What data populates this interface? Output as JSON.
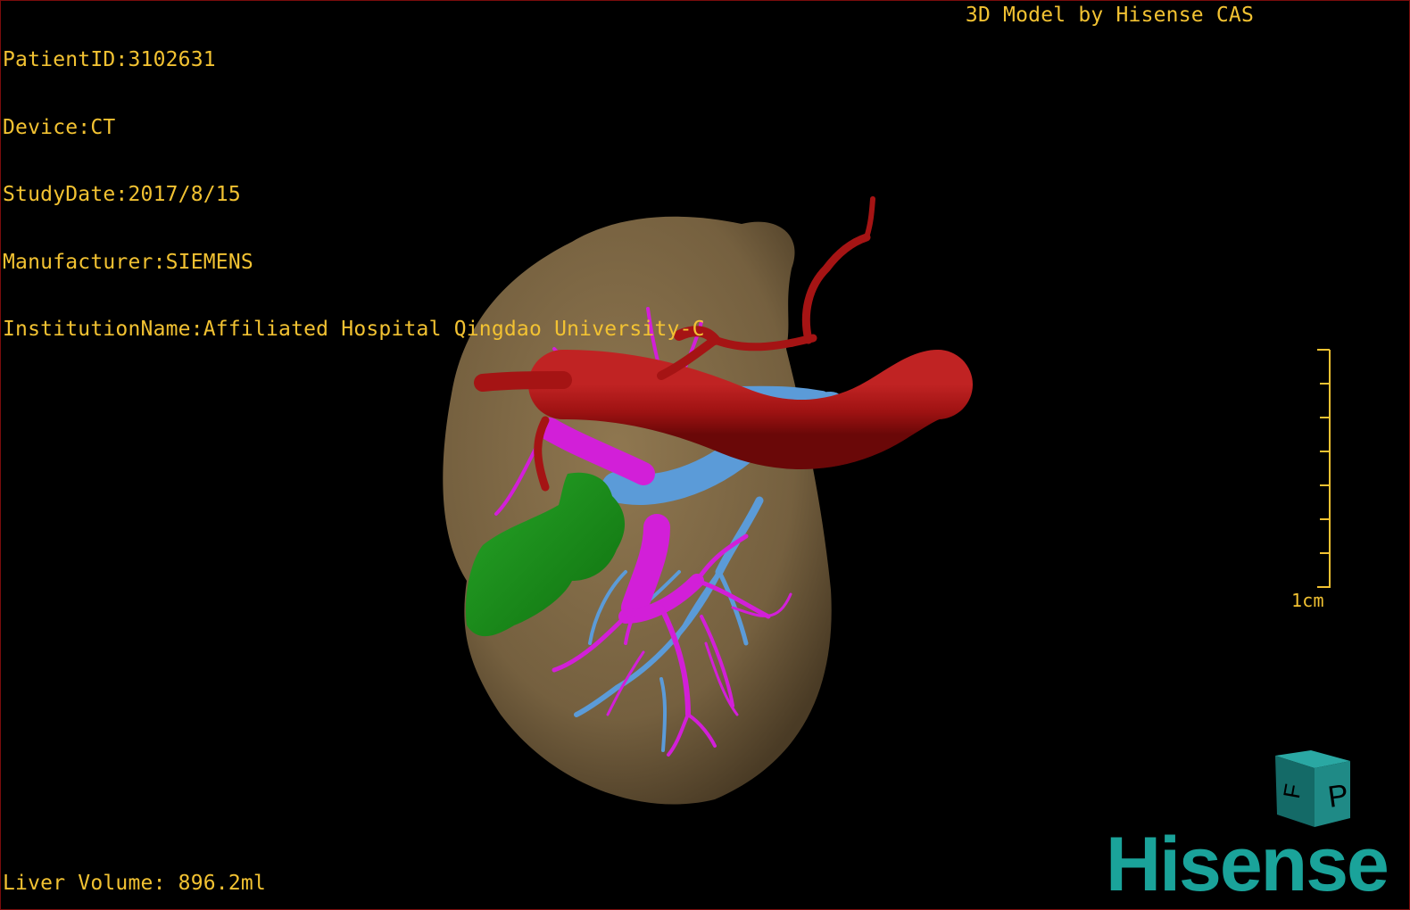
{
  "info": {
    "patient_id": "PatientID:3102631",
    "device": "Device:CT",
    "study_date": "StudyDate:2017/8/15",
    "manufacturer": "Manufacturer:SIEMENS",
    "institution": "InstitutionName:Affiliated Hospital Qingdao University-C"
  },
  "brand_text": "3D Model by Hisense CAS",
  "liver_volume": "Liver Volume: 896.2ml",
  "scale_label": "1cm",
  "orientation_cube": {
    "face_front": "P",
    "face_side": "F",
    "color": "#1f8a86"
  },
  "logo": {
    "text": "Hisense",
    "color": "#1aa39a"
  },
  "colors": {
    "text": "#f2c232",
    "liver": "#7d6644",
    "artery": "#a51414",
    "portal_vein": "#5b9bd8",
    "hepatic_vein": "#d21fd8",
    "gallbladder": "#1c8f1c",
    "border": "#7a0c0c"
  }
}
